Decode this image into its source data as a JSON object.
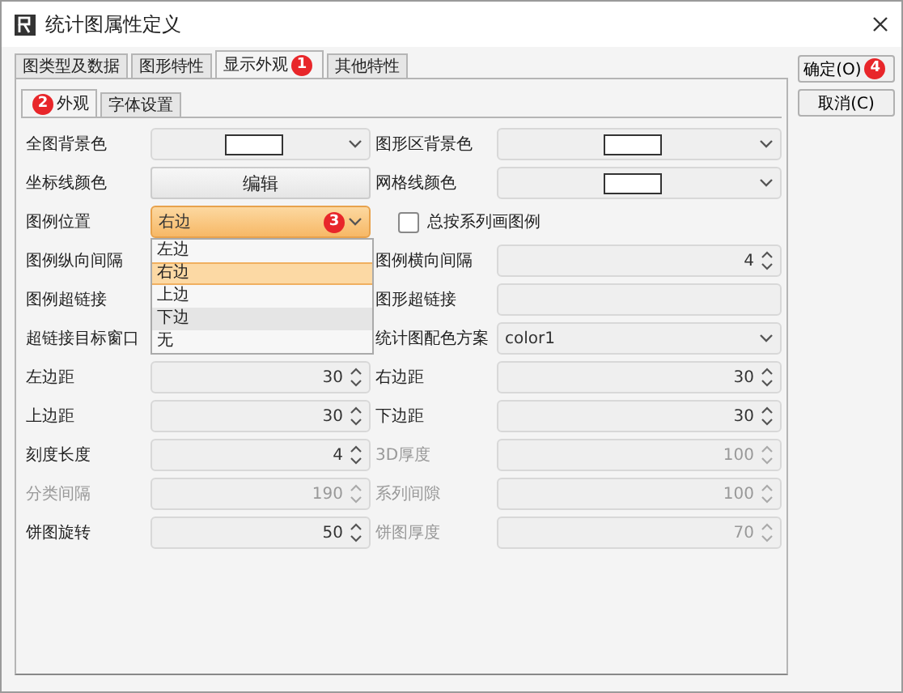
{
  "window": {
    "title": "统计图属性定义"
  },
  "tabs": [
    {
      "label": "图类型及数据",
      "selected": false
    },
    {
      "label": "图形特性",
      "selected": false
    },
    {
      "label": "显示外观",
      "selected": true,
      "badge": "1"
    },
    {
      "label": "其他特性",
      "selected": false
    }
  ],
  "subtabs": [
    {
      "label": "外观",
      "selected": true,
      "badge": "2"
    },
    {
      "label": "字体设置",
      "selected": false
    }
  ],
  "buttons": [
    {
      "label": "确定(O)",
      "badge": "4"
    },
    {
      "label": "取消(C)"
    }
  ],
  "rows": [
    {
      "left": {
        "label": "全图背景色",
        "field": {
          "kind": "color"
        }
      },
      "right": {
        "label": "图形区背景色",
        "field": {
          "kind": "color"
        }
      }
    },
    {
      "left": {
        "label": "坐标线颜色",
        "field": {
          "kind": "button",
          "value": "编辑"
        }
      },
      "right": {
        "label": "网格线颜色",
        "field": {
          "kind": "color"
        }
      }
    },
    {
      "left": {
        "label": "图例位置",
        "field": {
          "kind": "select",
          "value": "右边",
          "expanded": true,
          "badge": "3",
          "options": [
            {
              "label": "左边",
              "selected": false,
              "hovered": false
            },
            {
              "label": "右边",
              "selected": true,
              "hovered": false
            },
            {
              "label": "上边",
              "selected": false,
              "hovered": false
            },
            {
              "label": "下边",
              "selected": false,
              "hovered": true
            },
            {
              "label": "无",
              "selected": false,
              "hovered": false
            }
          ]
        }
      },
      "right": {
        "kind": "checkbox",
        "label": "总按系列画图例",
        "checked": false
      }
    },
    {
      "left": {
        "label": "图例纵向间隔"
      },
      "right": {
        "label": "图例横向间隔",
        "field": {
          "kind": "spin",
          "value": "4"
        }
      }
    },
    {
      "left": {
        "label": "图例超链接"
      },
      "right": {
        "label": "图形超链接",
        "field": {
          "kind": "text"
        }
      }
    },
    {
      "left": {
        "label": "超链接目标窗口"
      },
      "right": {
        "label": "统计图配色方案",
        "field": {
          "kind": "select",
          "value": "color1"
        }
      }
    },
    {
      "left": {
        "label": "左边距",
        "field": {
          "kind": "spin",
          "value": "30"
        }
      },
      "right": {
        "label": "右边距",
        "field": {
          "kind": "spin",
          "value": "30"
        }
      }
    },
    {
      "left": {
        "label": "上边距",
        "field": {
          "kind": "spin",
          "value": "30"
        }
      },
      "right": {
        "label": "下边距",
        "field": {
          "kind": "spin",
          "value": "30"
        }
      }
    },
    {
      "left": {
        "label": "刻度长度",
        "field": {
          "kind": "spin",
          "value": "4"
        }
      },
      "right": {
        "label": "3D厚度",
        "disabled": true,
        "field": {
          "kind": "spin",
          "value": "100"
        }
      }
    },
    {
      "left": {
        "label": "分类间隔",
        "disabled": true,
        "field": {
          "kind": "spin",
          "value": "190"
        }
      },
      "right": {
        "label": "系列间隙",
        "disabled": true,
        "field": {
          "kind": "spin",
          "value": "100"
        }
      }
    },
    {
      "left": {
        "label": "饼图旋转",
        "field": {
          "kind": "spin",
          "value": "50"
        }
      },
      "right": {
        "label": "饼图厚度",
        "disabled": true,
        "field": {
          "kind": "spin",
          "value": "70"
        }
      }
    }
  ]
}
